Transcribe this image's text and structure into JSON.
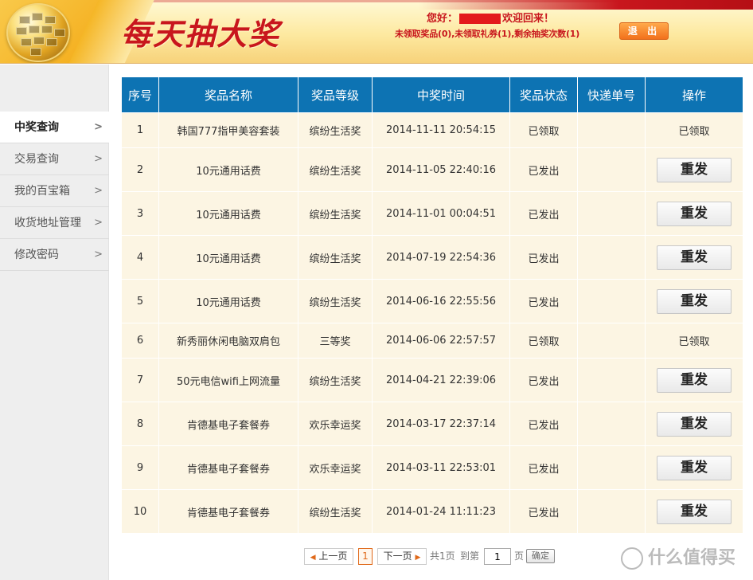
{
  "header": {
    "title": "每天抽大奖",
    "greeting_prefix": "您好：",
    "greeting_suffix": "欢迎回来！",
    "stats_text": "未领取奖品(0),未领取礼券(1),剩余抽奖次数(1)",
    "logout_label": "退 出"
  },
  "sidebar": {
    "items": [
      {
        "label": "中奖查询",
        "arrow": ">"
      },
      {
        "label": "交易查询",
        "arrow": ">"
      },
      {
        "label": "我的百宝箱",
        "arrow": ">"
      },
      {
        "label": "收货地址管理",
        "arrow": ">"
      },
      {
        "label": "修改密码",
        "arrow": ">"
      }
    ]
  },
  "table": {
    "headers": [
      "序号",
      "奖品名称",
      "奖品等级",
      "中奖时间",
      "奖品状态",
      "快递单号",
      "操作"
    ],
    "rows": [
      {
        "no": "1",
        "name": "韩国777指甲美容套装",
        "level": "缤纷生活奖",
        "time": "2014-11-11 20:54:15",
        "status": "已领取",
        "tracking": "",
        "action": "已领取",
        "action_type": "text"
      },
      {
        "no": "2",
        "name": "10元通用话费",
        "level": "缤纷生活奖",
        "time": "2014-11-05 22:40:16",
        "status": "已发出",
        "tracking": "",
        "action": "重发",
        "action_type": "button"
      },
      {
        "no": "3",
        "name": "10元通用话费",
        "level": "缤纷生活奖",
        "time": "2014-11-01 00:04:51",
        "status": "已发出",
        "tracking": "",
        "action": "重发",
        "action_type": "button"
      },
      {
        "no": "4",
        "name": "10元通用话费",
        "level": "缤纷生活奖",
        "time": "2014-07-19 22:54:36",
        "status": "已发出",
        "tracking": "",
        "action": "重发",
        "action_type": "button"
      },
      {
        "no": "5",
        "name": "10元通用话费",
        "level": "缤纷生活奖",
        "time": "2014-06-16 22:55:56",
        "status": "已发出",
        "tracking": "",
        "action": "重发",
        "action_type": "button"
      },
      {
        "no": "6",
        "name": "新秀丽休闲电脑双肩包",
        "level": "三等奖",
        "time": "2014-06-06 22:57:57",
        "status": "已领取",
        "tracking": "",
        "action": "已领取",
        "action_type": "text"
      },
      {
        "no": "7",
        "name": "50元电信wifi上网流量",
        "level": "缤纷生活奖",
        "time": "2014-04-21 22:39:06",
        "status": "已发出",
        "tracking": "",
        "action": "重发",
        "action_type": "button"
      },
      {
        "no": "8",
        "name": "肯德基电子套餐券",
        "level": "欢乐幸运奖",
        "time": "2014-03-17 22:37:14",
        "status": "已发出",
        "tracking": "",
        "action": "重发",
        "action_type": "button"
      },
      {
        "no": "9",
        "name": "肯德基电子套餐券",
        "level": "欢乐幸运奖",
        "time": "2014-03-11 22:53:01",
        "status": "已发出",
        "tracking": "",
        "action": "重发",
        "action_type": "button"
      },
      {
        "no": "10",
        "name": "肯德基电子套餐券",
        "level": "缤纷生活奖",
        "time": "2014-01-24 11:11:23",
        "status": "已发出",
        "tracking": "",
        "action": "重发",
        "action_type": "button"
      }
    ]
  },
  "pager": {
    "prev_label": "上一页",
    "current_page": "1",
    "next_label": "下一页",
    "total_text": "共1页",
    "goto_prefix": "到第",
    "goto_value": "1",
    "goto_suffix": "页",
    "confirm_label": "确定"
  },
  "watermark": {
    "text": "什么值得买"
  },
  "colors": {
    "brand_red": "#c8161d",
    "header_blue": "#0d73b3",
    "row_bg": "#fcf5e3",
    "accent_orange": "#f2711c"
  }
}
